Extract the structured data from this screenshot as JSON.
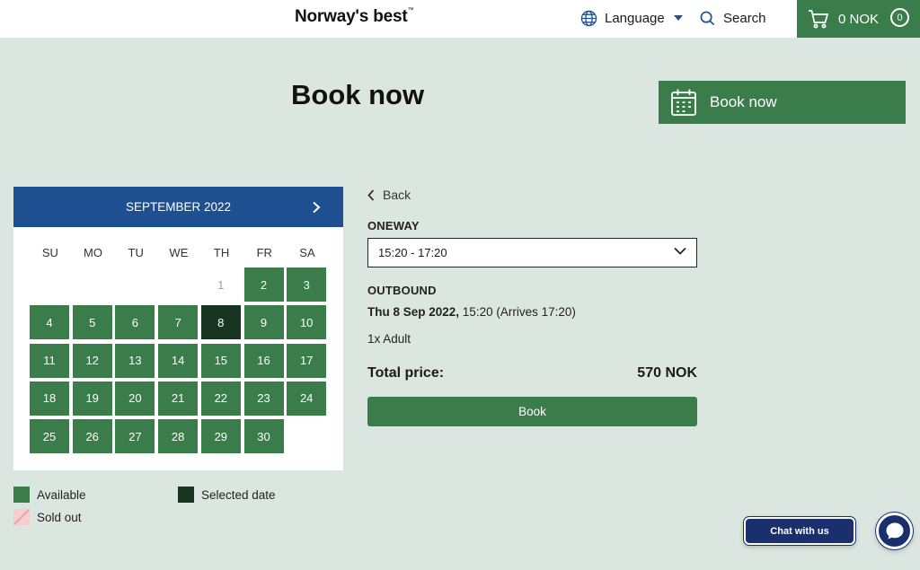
{
  "header": {
    "brand": "Norway's best",
    "brand_tm": "™",
    "language_label": "Language",
    "search_label": "Search",
    "cart_amount": "0 NOK",
    "cart_count": "0"
  },
  "page": {
    "title": "Book now",
    "book_now_banner": "Book now"
  },
  "calendar": {
    "month_label": "SEPTEMBER 2022",
    "weekdays": [
      "SU",
      "MO",
      "TU",
      "WE",
      "TH",
      "FR",
      "SA"
    ],
    "first_weekday_index": 4,
    "days_in_month": 30,
    "unavailable_days": [
      1
    ],
    "selected_day": 8
  },
  "legend": {
    "available": "Available",
    "selected": "Selected date",
    "sold_out": "Sold out"
  },
  "booking": {
    "back_label": "Back",
    "oneway_label": "ONEWAY",
    "selected_departure": "15:20 - 17:20",
    "outbound_label": "OUTBOUND",
    "outbound_date": "Thu 8 Sep 2022,",
    "outbound_time": " 15:20 (Arrives 17:20)",
    "passengers": "1x Adult",
    "total_label": "Total price:",
    "total_value": "570 NOK",
    "book_button": "Book"
  },
  "chat": {
    "label": "Chat with us"
  },
  "colors": {
    "brand_green": "#3a7d4a",
    "selected_green": "#173521",
    "calendar_blue": "#1e4f91",
    "chat_navy": "#1a2f6e",
    "background": "#dce6e0"
  }
}
